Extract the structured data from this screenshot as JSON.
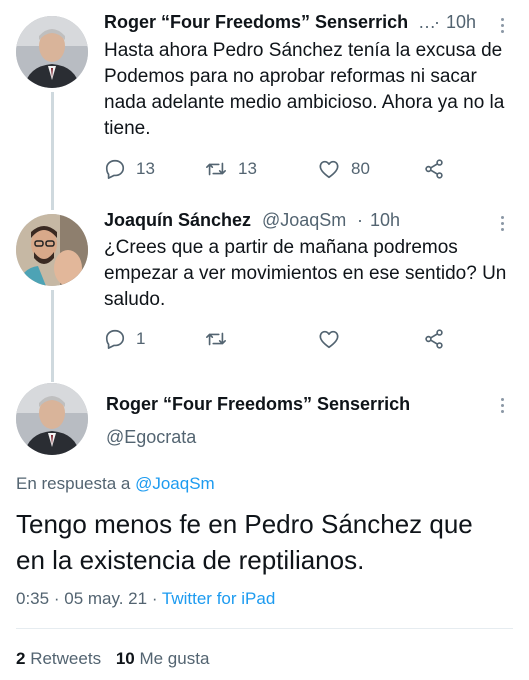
{
  "tweets": [
    {
      "name": "Roger “Four Freedoms” Senserrich",
      "ellipsis": "…",
      "time_sep": "·",
      "time": "10h",
      "text": "Hasta ahora Pedro Sánchez tenía la excusa de Podemos para no aprobar reformas ni sacar nada adelante medio ambicioso. Ahora ya no la tiene.",
      "replies": "13",
      "retweets": "13",
      "likes": "80"
    },
    {
      "name": "Joaquín Sánchez",
      "handle": "@JoaqSm",
      "time_sep": "·",
      "time": "10h",
      "text": "¿Crees que a partir de mañana podremos empezar a ver movimientos en ese sentido? Un saludo.",
      "replies": "1"
    }
  ],
  "main_tweet": {
    "name": "Roger “Four Freedoms” Senserrich",
    "handle": "@Egocrata",
    "reply_prefix": "En respuesta a",
    "reply_to": "@JoaqSm",
    "text": "Tengo menos fe en Pedro Sánchez que en la existencia de reptilianos.",
    "time": "0:35",
    "sep": "·",
    "date": "05 may. 21",
    "sep2": "·",
    "source": "Twitter for iPad",
    "retweets_count": "2",
    "retweets_label": "Retweets",
    "likes_count": "10",
    "likes_label": "Me gusta"
  },
  "icons": {
    "reply": "reply-icon",
    "retweet": "retweet-icon",
    "like": "heart-icon",
    "share": "share-icon",
    "more": "more-vertical-icon"
  },
  "colors": {
    "link": "#1d9bf0",
    "muted": "#536471",
    "thread_line": "#cfd9de"
  }
}
